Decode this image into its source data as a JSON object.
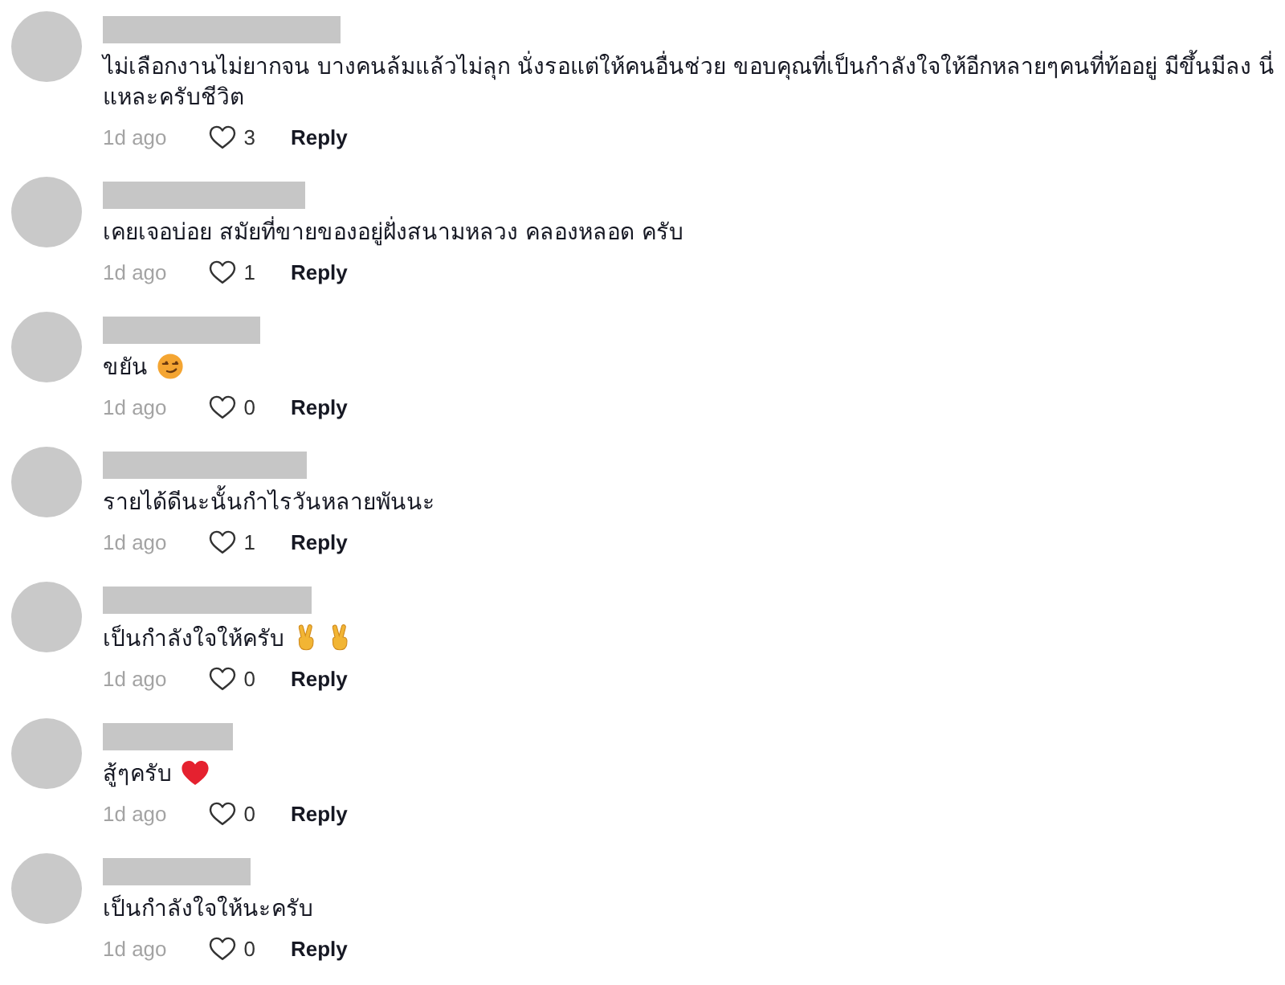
{
  "comments": [
    {
      "text": "ไม่เลือกงานไม่ยากจน บางคนล้มแล้วไม่ลุก นั่งรอแต่ให้คนอื่นช่วย ขอบคุณที่เป็นกำลังใจให้อีกหลายๆคนที่ท้ออยู่ มีขึ้นมีลง นี่แหละครับชีวิต",
      "time": "1d ago",
      "liked": false,
      "likes": "3",
      "reply": "Reply"
    },
    {
      "text": "เคยเจอบ่อย สมัยที่ขายของอยู่ฝั่งสนามหลวง คลองหลอด ครับ",
      "time": "1d ago",
      "liked": false,
      "likes": "1",
      "reply": "Reply"
    },
    {
      "text": "ขยัน",
      "emojis": [
        {
          "kind": "smirk"
        }
      ],
      "time": "1d ago",
      "liked": false,
      "likes": "0",
      "reply": "Reply"
    },
    {
      "text": "รายได้ดีนะนั้นกำไรวันหลายพันนะ",
      "time": "1d ago",
      "liked": false,
      "likes": "1",
      "reply": "Reply"
    },
    {
      "text": "เป็นกำลังใจให้ครับ",
      "emojis": [
        {
          "kind": "victory_hand"
        },
        {
          "kind": "victory_hand"
        }
      ],
      "time": "1d ago",
      "liked": false,
      "likes": "0",
      "reply": "Reply"
    },
    {
      "text": "สู้ๆครับ",
      "emojis": [
        {
          "kind": "heart"
        }
      ],
      "time": "1d ago",
      "liked": false,
      "likes": "0",
      "reply": "Reply"
    },
    {
      "text": "เป็นกำลังใจให้นะครับ",
      "time": "1d ago",
      "liked": false,
      "likes": "0",
      "reply": "Reply"
    }
  ]
}
